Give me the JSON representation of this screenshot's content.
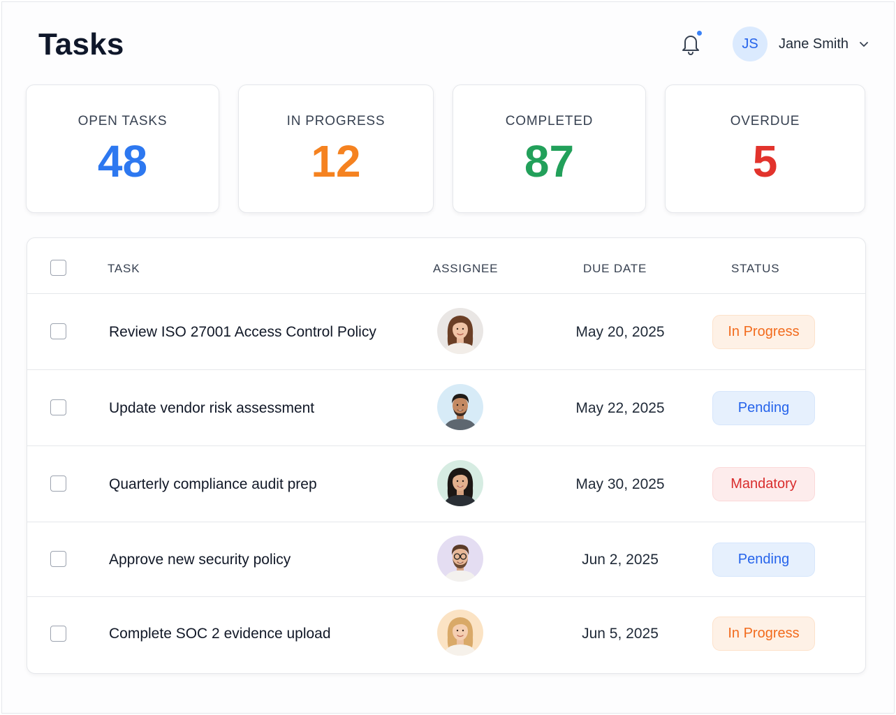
{
  "header": {
    "title": "Tasks",
    "notification_dot_color": "#3b82f6",
    "user": {
      "initials": "JS",
      "name": "Jane Smith"
    }
  },
  "stats": [
    {
      "label": "OPEN TASKS",
      "value": "48",
      "color": "#2d78f0"
    },
    {
      "label": "IN PROGRESS",
      "value": "12",
      "color": "#f58220"
    },
    {
      "label": "COMPLETED",
      "value": "87",
      "color": "#22a05a"
    },
    {
      "label": "OVERDUE",
      "value": "5",
      "color": "#e2332c"
    }
  ],
  "table": {
    "columns": [
      "TASK",
      "ASSIGNEE",
      "DUE DATE",
      "STATUS"
    ],
    "rows": [
      {
        "task": "Review ISO 27001 Access Control Policy",
        "assignee_icon": "avatar-woman-brown-hair",
        "due": "May 20, 2025",
        "status": "In Progress",
        "status_type": "in-progress"
      },
      {
        "task": "Update vendor risk assessment",
        "assignee_icon": "avatar-man-dark-hair",
        "due": "May 22, 2025",
        "status": "Pending",
        "status_type": "pending"
      },
      {
        "task": "Quarterly compliance audit prep",
        "assignee_icon": "avatar-woman-dark-hair",
        "due": "May 30, 2025",
        "status": "Mandatory",
        "status_type": "mandatory"
      },
      {
        "task": "Approve new security policy",
        "assignee_icon": "avatar-man-glasses-beard",
        "due": "Jun 2, 2025",
        "status": "Pending",
        "status_type": "pending"
      },
      {
        "task": "Complete SOC 2 evidence upload",
        "assignee_icon": "avatar-woman-blonde-hair",
        "due": "Jun 5, 2025",
        "status": "In Progress",
        "status_type": "in-progress"
      }
    ]
  },
  "status_colors": {
    "in-progress": {
      "bg": "#fef1e6",
      "border": "#fde2cb",
      "text": "#f26b1d"
    },
    "pending": {
      "bg": "#e6f0fd",
      "border": "#d6e6fc",
      "text": "#2563eb"
    },
    "mandatory": {
      "bg": "#fdecec",
      "border": "#fbd9d9",
      "text": "#d92d2d"
    }
  }
}
